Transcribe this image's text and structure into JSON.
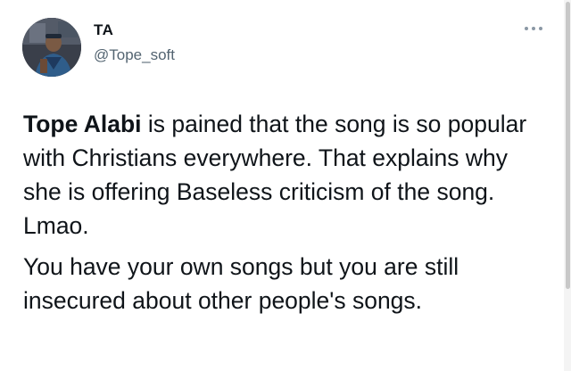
{
  "tweet": {
    "author": {
      "display_name": "TA",
      "handle": "@Tope_soft",
      "avatar_icon": "profile-photo"
    },
    "more_icon": "ellipsis-icon",
    "paragraph1": {
      "mention": "Tope Alabi",
      "text": " is pained that the song is so popular with Christians everywhere. That explains why she is offering Baseless criticism of the song. Lmao."
    },
    "paragraph2": {
      "text": "You have your own songs but you are still insecured about other people's songs."
    }
  },
  "colors": {
    "text": "#0f1419",
    "secondary_text": "#536471",
    "background": "#ffffff"
  }
}
